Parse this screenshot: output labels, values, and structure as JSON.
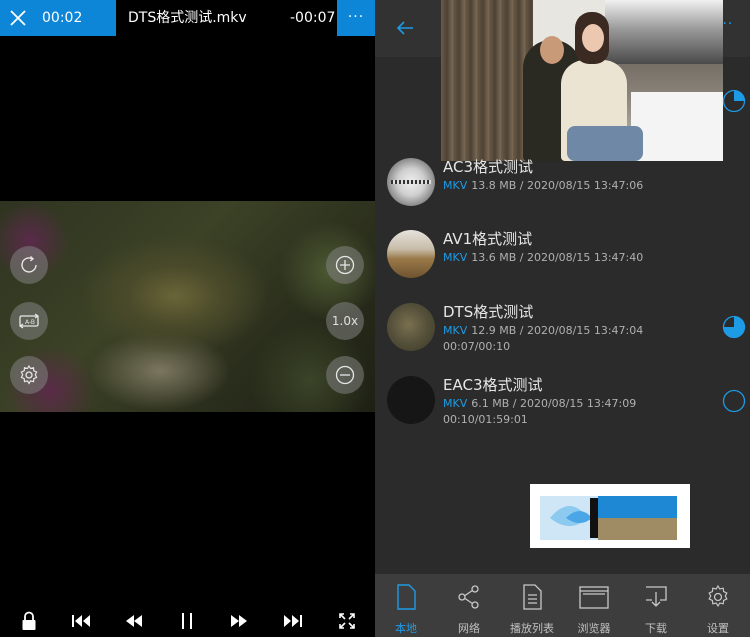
{
  "player": {
    "elapsed": "00:02",
    "title": "DTS格式测试.mkv",
    "remaining": "-00:07",
    "more": "···",
    "speed_label": "1.0x",
    "icons": [
      "close-icon",
      "more-icon",
      "rotate-icon",
      "ab-repeat-icon",
      "settings-icon",
      "zoom-in-icon",
      "zoom-out-icon",
      "lock-icon",
      "skip-previous-icon",
      "rewind-icon",
      "pause-icon",
      "fast-forward-icon",
      "skip-next-icon",
      "fullscreen-icon"
    ],
    "accent": "#0d86d8"
  },
  "library": {
    "menu": "···",
    "items": [
      {
        "title": "AC3格式测试",
        "format": "MKV",
        "meta": "13.8 MB / 2020/08/15 13:47:06",
        "progress": ""
      },
      {
        "title": "AV1格式测试",
        "format": "MKV",
        "meta": "13.6 MB / 2020/08/15 13:47:40",
        "progress": ""
      },
      {
        "title": "DTS格式测试",
        "format": "MKV",
        "meta": "12.9 MB / 2020/08/15 13:47:04",
        "progress": "00:07/00:10"
      },
      {
        "title": "EAC3格式测试",
        "format": "MKV",
        "meta": "6.1 MB / 2020/08/15 13:47:09",
        "progress": "00:10/01:59:01"
      }
    ],
    "tabs": [
      {
        "label": "本地",
        "icon": "file-icon"
      },
      {
        "label": "网络",
        "icon": "share-icon"
      },
      {
        "label": "播放列表",
        "icon": "playlist-icon"
      },
      {
        "label": "浏览器",
        "icon": "browser-icon"
      },
      {
        "label": "下载",
        "icon": "download-icon"
      },
      {
        "label": "设置",
        "icon": "settings-icon"
      }
    ],
    "accent": "#1e9be5"
  }
}
